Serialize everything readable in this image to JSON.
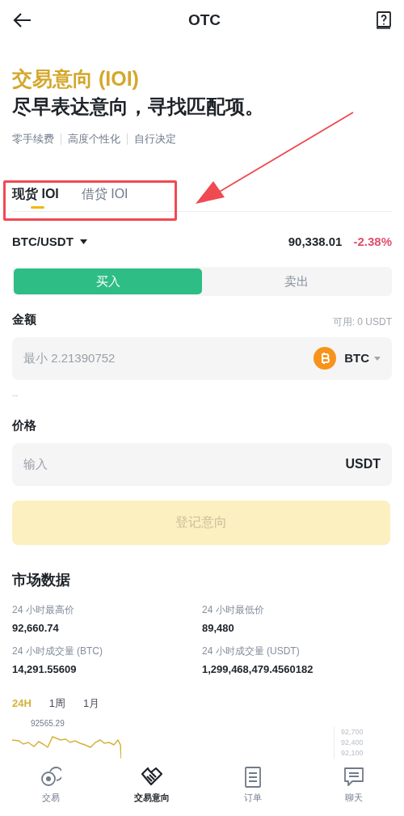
{
  "header": {
    "title": "OTC"
  },
  "hero": {
    "title": "交易意向 (IOI)",
    "subtitle": "尽早表达意向，寻找匹配项。",
    "features": [
      "零手续费",
      "高度个性化",
      "自行决定"
    ]
  },
  "tabs": [
    {
      "label": "现货 IOI",
      "selected": true
    },
    {
      "label": "借贷 IOI",
      "selected": false
    }
  ],
  "pair": {
    "symbol": "BTC/USDT",
    "price": "90,338.01",
    "change": "-2.38%"
  },
  "sides": [
    {
      "label": "买入",
      "selected": true
    },
    {
      "label": "卖出",
      "selected": false
    }
  ],
  "amount": {
    "label": "金额",
    "available": "可用: 0 USDT",
    "placeholder": "最小 2.21390752",
    "currency": "BTC",
    "hint": "--"
  },
  "price": {
    "label": "价格",
    "placeholder": "输入",
    "currency": "USDT"
  },
  "submit": {
    "label": "登记意向",
    "disabled": true
  },
  "market": {
    "title": "市场数据",
    "stats": [
      {
        "label": "24 小时最高价",
        "value": "92,660.74"
      },
      {
        "label": "24 小时最低价",
        "value": "89,480"
      },
      {
        "label": "24 小时成交量 (BTC)",
        "value": "14,291.55609"
      },
      {
        "label": "24 小时成交量 (USDT)",
        "value": "1,299,468,479.4560182"
      }
    ],
    "ranges": [
      {
        "label": "24H",
        "selected": true
      },
      {
        "label": "1周",
        "selected": false
      },
      {
        "label": "1月",
        "selected": false
      }
    ],
    "peak_label": "92565.29",
    "axis_labels": [
      "92,700",
      "92,400",
      "92,100"
    ]
  },
  "bottom_nav": [
    {
      "label": "交易",
      "selected": false
    },
    {
      "label": "交易意向",
      "selected": true
    },
    {
      "label": "订单",
      "selected": false
    },
    {
      "label": "聊天",
      "selected": false
    }
  ]
}
